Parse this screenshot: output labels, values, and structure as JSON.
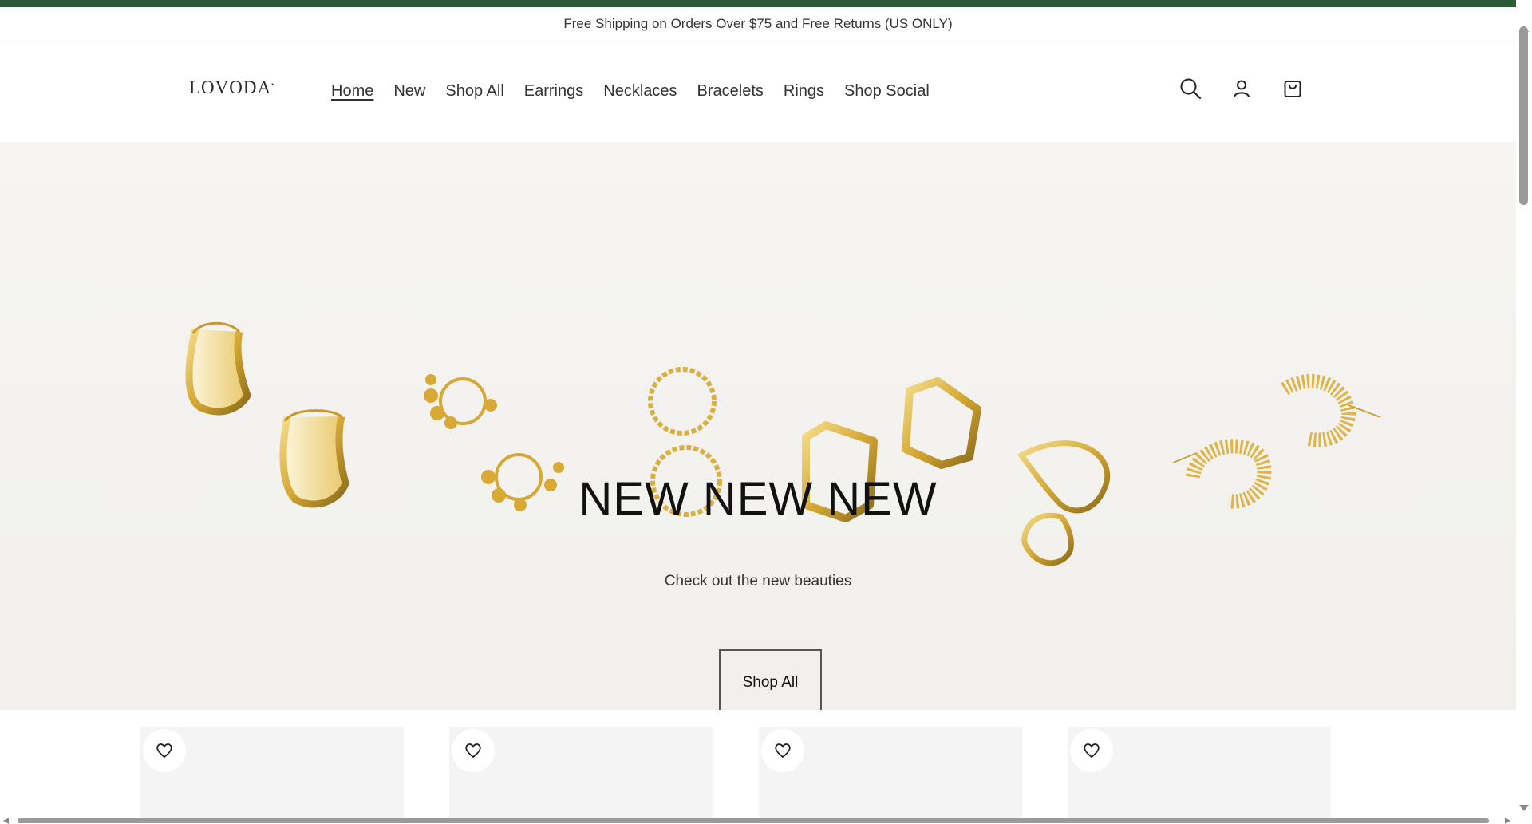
{
  "announcement": {
    "text": "Free Shipping on Orders Over $75 and Free Returns (US ONLY)"
  },
  "brand": {
    "logo": "LOVODA"
  },
  "nav": {
    "items": [
      {
        "label": "Home",
        "active": true
      },
      {
        "label": "New"
      },
      {
        "label": "Shop All"
      },
      {
        "label": "Earrings"
      },
      {
        "label": "Necklaces"
      },
      {
        "label": "Bracelets"
      },
      {
        "label": "Rings"
      },
      {
        "label": "Shop Social"
      }
    ]
  },
  "header_icons": [
    "search-icon",
    "account-icon",
    "cart-icon"
  ],
  "hero": {
    "title": "NEW NEW NEW",
    "subtitle": "Check out the new beauties",
    "button_label": "Shop All"
  },
  "products": {
    "wishlist_icon": "heart-icon",
    "count_visible": 4
  },
  "colors": {
    "top_stripe": "#2c5a36",
    "gold": "#d9b23a",
    "hero_bg": "#f4f3f0"
  }
}
